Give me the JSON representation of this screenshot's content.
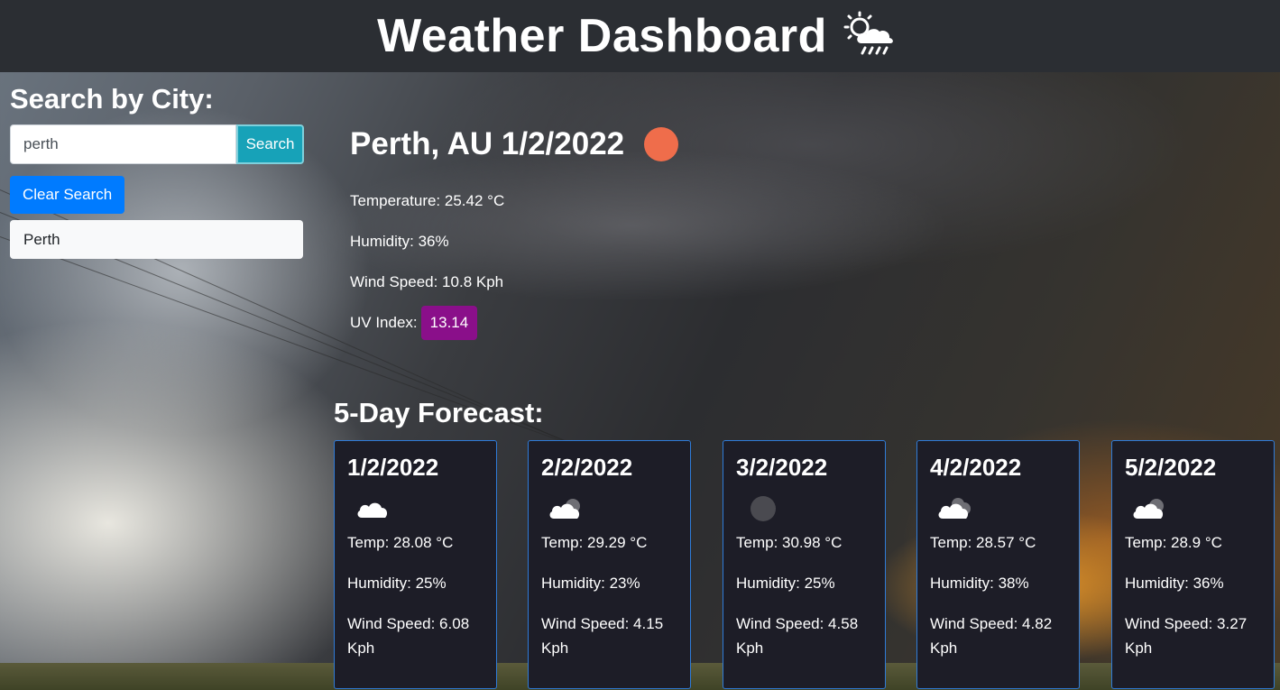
{
  "header": {
    "title": "Weather Dashboard",
    "icon": "sun-behind-rain-cloud-icon"
  },
  "sidebar": {
    "heading": "Search by City:",
    "search": {
      "value": "perth",
      "placeholder": "",
      "button_label": "Search"
    },
    "clear_label": "Clear Search",
    "history": [
      {
        "label": "Perth"
      }
    ]
  },
  "current": {
    "title": "Perth, AU 1/2/2022",
    "icon": "sun-icon",
    "temperature": "Temperature: 25.42 °C",
    "humidity": "Humidity: 36%",
    "wind": "Wind Speed: 10.8 Kph",
    "uv_label": "UV Index:",
    "uv_value": "13.14",
    "uv_color": "#8a0f8a"
  },
  "forecast": {
    "heading": "5-Day Forecast:",
    "days": [
      {
        "date": "1/2/2022",
        "icon": "cloud-icon",
        "temp": "Temp: 28.08 °C",
        "humidity": "Humidity: 25%",
        "wind": "Wind Speed: 6.08 Kph"
      },
      {
        "date": "2/2/2022",
        "icon": "broken-clouds-icon",
        "temp": "Temp: 29.29 °C",
        "humidity": "Humidity: 23%",
        "wind": "Wind Speed: 4.15 Kph"
      },
      {
        "date": "3/2/2022",
        "icon": "overcast-icon",
        "temp": "Temp: 30.98 °C",
        "humidity": "Humidity: 25%",
        "wind": "Wind Speed: 4.58 Kph"
      },
      {
        "date": "4/2/2022",
        "icon": "broken-clouds-icon",
        "temp": "Temp: 28.57 °C",
        "humidity": "Humidity: 38%",
        "wind": "Wind Speed: 4.82 Kph"
      },
      {
        "date": "5/2/2022",
        "icon": "broken-clouds-icon",
        "temp": "Temp: 28.9 °C",
        "humidity": "Humidity: 36%",
        "wind": "Wind Speed: 3.27 Kph"
      }
    ]
  },
  "colors": {
    "header_bg": "#2b2e33",
    "search_button": "#17a2b8",
    "clear_button": "#007bff",
    "card_bg": "#1d1d27",
    "card_border": "#2f7bd8",
    "sun": "#ef6d4b"
  }
}
